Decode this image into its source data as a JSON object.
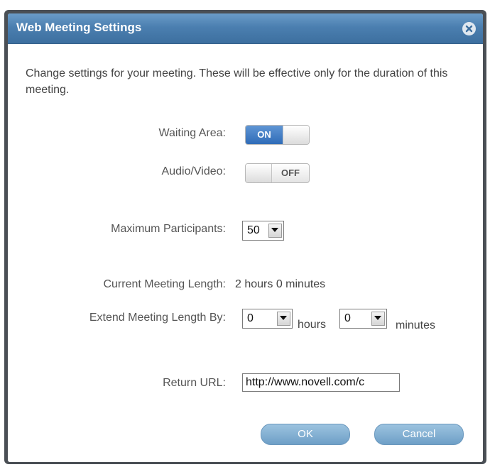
{
  "dialog": {
    "title": "Web Meeting Settings",
    "close_icon": "close-icon",
    "intro": "Change settings for your meeting. These will be effective only for the duration of this meeting."
  },
  "settings": {
    "waiting_area": {
      "label": "Waiting Area:",
      "state_text": "ON",
      "state": "on"
    },
    "audio_video": {
      "label": "Audio/Video:",
      "state_text": "OFF",
      "state": "off"
    },
    "max_participants": {
      "label": "Maximum Participants:",
      "value": "50"
    },
    "current_length": {
      "label": "Current Meeting Length:",
      "value": "2 hours 0 minutes"
    },
    "extend_length": {
      "label": "Extend Meeting Length By:",
      "hours_value": "0",
      "hours_unit": "hours",
      "minutes_value": "0",
      "minutes_unit": "minutes"
    },
    "return_url": {
      "label": "Return URL:",
      "value": "http://www.novell.com/c"
    }
  },
  "buttons": {
    "ok": "OK",
    "cancel": "Cancel"
  },
  "colors": {
    "title_bar": "#4b7fb0",
    "toggle_on": "#2f6cb8",
    "button": "#7eadd2"
  }
}
